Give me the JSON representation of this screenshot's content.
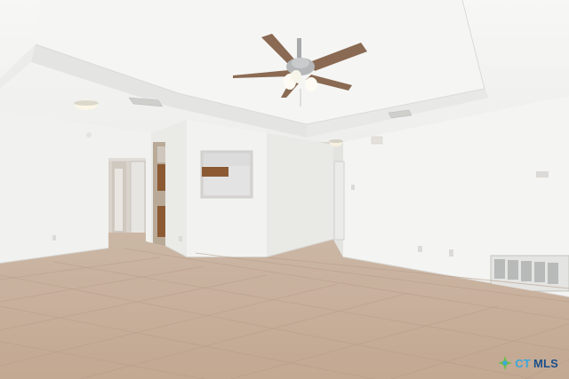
{
  "scene": {
    "description_room": "empty",
    "colors": {
      "wall": "#f3f3f1",
      "wall_shadow": "#e2e2df",
      "ceiling": "#f6f6f5",
      "floor": "#c9b3a0",
      "floor_grout": "#b59c88",
      "fan_blade": "#8a6a52",
      "fan_metal": "#a7a9ab",
      "door_frame": "#d8d5d0",
      "hallway": "#c8b9a8",
      "cabinet": "#8b5a33"
    },
    "icons": {
      "ceiling_fan": "ceiling-fan-icon",
      "light": "ceiling-light-icon",
      "vent": "air-vent-icon"
    }
  },
  "watermark": {
    "part_a": "CT",
    "part_b": "MLS"
  }
}
